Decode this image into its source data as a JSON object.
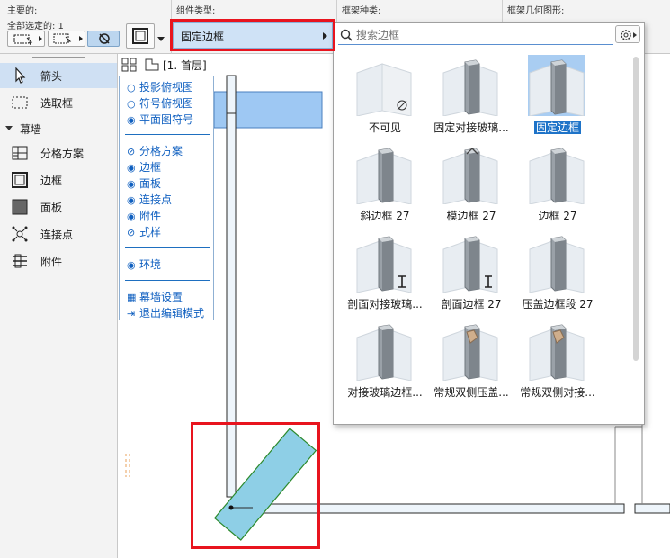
{
  "topbar": {
    "main_label": "主要的:",
    "selected_count": "全部选定的: 1",
    "component_type_label": "组件类型:",
    "frame_type_label": "框架种类:",
    "frame_geometry_label": "框架几何图形:"
  },
  "component_select": {
    "value": "固定边框"
  },
  "search": {
    "placeholder": "搜索边框"
  },
  "toolbox": {
    "items": [
      {
        "label": "箭头",
        "icon": "arrow-cursor-icon",
        "selected": true
      },
      {
        "label": "选取框",
        "icon": "marquee-icon",
        "selected": false
      }
    ],
    "group": {
      "label": "幕墙",
      "icon": "collapse-triangle-icon"
    },
    "group_items": [
      {
        "label": "分格方案",
        "icon": "scheme-icon"
      },
      {
        "label": "边框",
        "icon": "frame-icon"
      },
      {
        "label": "面板",
        "icon": "panel-icon"
      },
      {
        "label": "连接点",
        "icon": "junction-icon"
      },
      {
        "label": "附件",
        "icon": "accessory-icon"
      }
    ]
  },
  "plan": {
    "floor_label": "[1. 首层]"
  },
  "view_panel": {
    "radios": [
      {
        "label": "投影俯视图",
        "checked": false
      },
      {
        "label": "符号俯视图",
        "checked": false
      },
      {
        "label": "平面图符号",
        "checked": true
      }
    ],
    "toggles": [
      {
        "label": "分格方案",
        "visible": false
      },
      {
        "label": "边框",
        "visible": true
      },
      {
        "label": "面板",
        "visible": true
      },
      {
        "label": "连接点",
        "visible": true
      },
      {
        "label": "附件",
        "visible": true
      },
      {
        "label": "式样",
        "visible": false
      }
    ],
    "environment": {
      "label": "环境",
      "visible": true
    },
    "actions": [
      {
        "label": "幕墙设置",
        "icon": "curtain-wall-settings-icon"
      },
      {
        "label": "退出编辑模式",
        "icon": "exit-edit-icon"
      }
    ]
  },
  "gallery": {
    "items": [
      {
        "label": "不可见",
        "selected": false
      },
      {
        "label": "固定对接玻璃...",
        "selected": false
      },
      {
        "label": "固定边框",
        "selected": true
      },
      {
        "label": "斜边框 27",
        "selected": false
      },
      {
        "label": "模边框 27",
        "selected": false
      },
      {
        "label": "边框 27",
        "selected": false
      },
      {
        "label": "剖面对接玻璃...",
        "selected": false
      },
      {
        "label": "剖面边框 27",
        "selected": false
      },
      {
        "label": "压盖边框段 27",
        "selected": false
      },
      {
        "label": "对接玻璃边框...",
        "selected": false
      },
      {
        "label": "常规双侧压盖...",
        "selected": false
      },
      {
        "label": "常规双侧对接...",
        "selected": false
      }
    ]
  },
  "colors": {
    "selection_blue": "#1e73c8",
    "highlight_red": "#e8141e",
    "panel_fill": "#8ecfe6",
    "link_blue": "#1060c0"
  }
}
